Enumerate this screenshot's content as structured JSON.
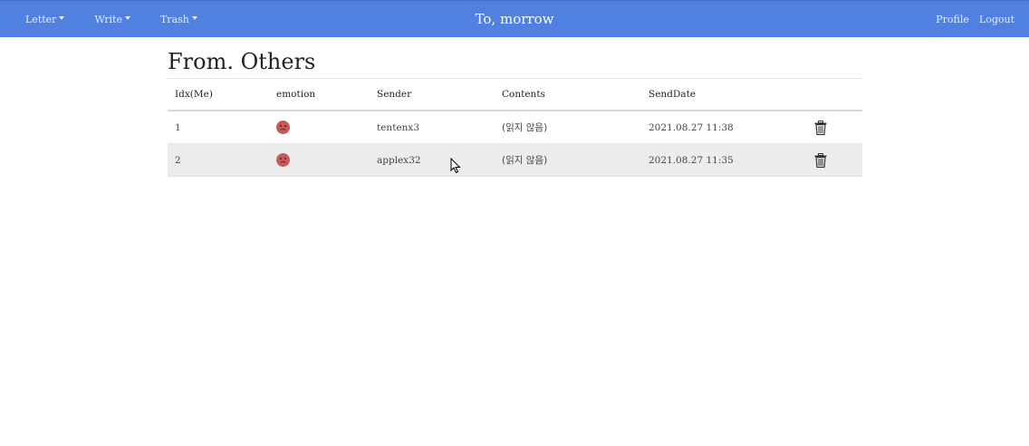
{
  "navbar": {
    "menus": [
      {
        "label": "Letter"
      },
      {
        "label": "Write"
      },
      {
        "label": "Trash"
      }
    ],
    "brand": "To, morrow",
    "profile": "Profile",
    "logout": "Logout",
    "color": "#5080e0"
  },
  "page": {
    "title": "From. Others"
  },
  "table": {
    "headers": [
      "Idx(Me)",
      "emotion",
      "Sender",
      "Contents",
      "SendDate"
    ],
    "rows": [
      {
        "idx": "1",
        "emotion": "angry-face-icon",
        "sender": "tentenx3",
        "contents": "(읽지 않음)",
        "date": "2021.08.27 11:38",
        "action": "trash-icon"
      },
      {
        "idx": "2",
        "emotion": "angry-face-icon",
        "sender": "applex32",
        "contents": "(읽지 않음)",
        "date": "2021.08.27 11:35",
        "action": "trash-icon"
      }
    ]
  }
}
